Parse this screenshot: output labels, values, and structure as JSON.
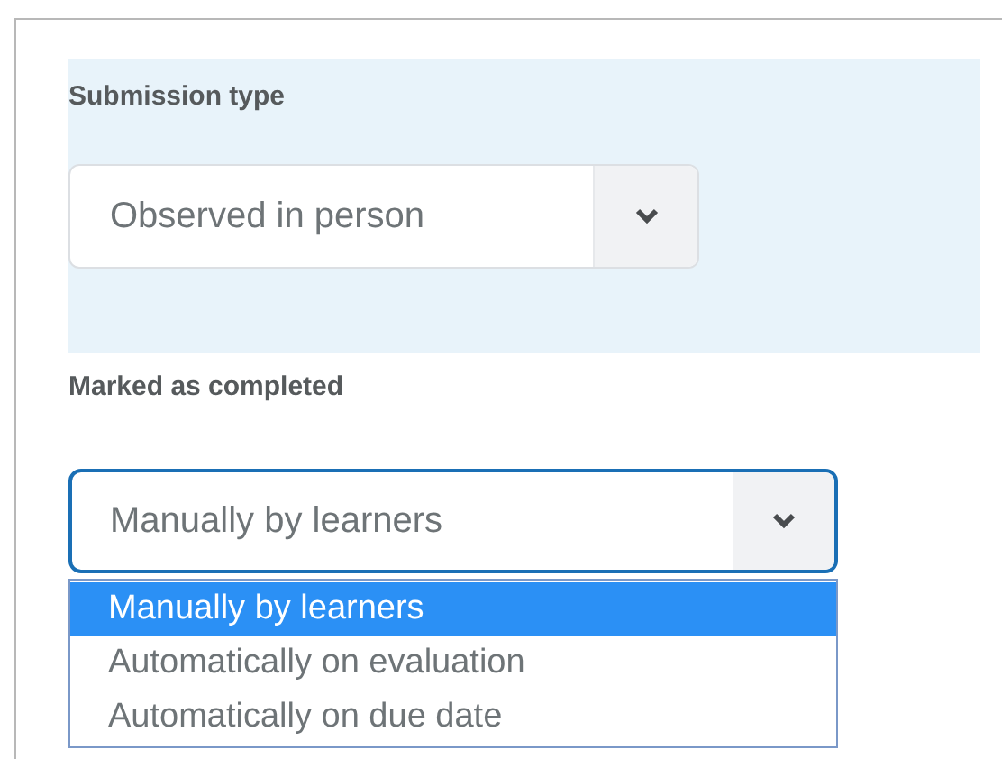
{
  "submission_type": {
    "label": "Submission type",
    "value": "Observed in person"
  },
  "marked_as_completed": {
    "label": "Marked as completed",
    "value": "Manually by learners",
    "expanded": true,
    "options": [
      {
        "label": "Manually by learners",
        "selected": true
      },
      {
        "label": "Automatically on evaluation",
        "selected": false
      },
      {
        "label": "Automatically on due date",
        "selected": false
      }
    ]
  }
}
